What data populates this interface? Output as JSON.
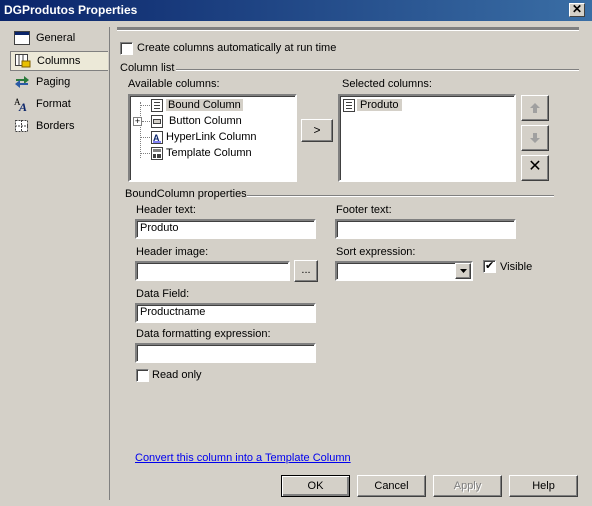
{
  "window": {
    "title": "DGProdutos Properties",
    "close_label": "✕"
  },
  "nav": [
    {
      "label": "General",
      "icon": "general-icon"
    },
    {
      "label": "Columns",
      "icon": "columns-icon",
      "selected": true
    },
    {
      "label": "Paging",
      "icon": "paging-icon"
    },
    {
      "label": "Format",
      "icon": "format-icon"
    },
    {
      "label": "Borders",
      "icon": "borders-icon"
    }
  ],
  "create_auto": {
    "label": "Create columns automatically at run time",
    "checked": false
  },
  "column_list": {
    "group_label": "Column list",
    "available_label": "Available columns:",
    "selected_label": "Selected columns:",
    "available": [
      {
        "label": "Bound Column",
        "icon": "bound-column-icon",
        "highlighted": true
      },
      {
        "label": "Button Column",
        "icon": "button-column-icon",
        "expander": "+"
      },
      {
        "label": "HyperLink Column",
        "icon": "hyperlink-column-icon"
      },
      {
        "label": "Template Column",
        "icon": "template-column-icon"
      }
    ],
    "selected": [
      {
        "label": "Produto",
        "icon": "bound-column-icon"
      }
    ],
    "add_label": ">",
    "up_icon": "arrow-up-icon",
    "down_icon": "arrow-down-icon",
    "delete_label": "✕"
  },
  "bound_props": {
    "group_label": "BoundColumn properties",
    "header_text_label": "Header text:",
    "header_text_value": "Produto",
    "footer_text_label": "Footer text:",
    "footer_text_value": "",
    "header_image_label": "Header image:",
    "header_image_value": "",
    "browse_label": "...",
    "sort_label": "Sort expression:",
    "sort_value": "",
    "visible_label": "Visible",
    "visible_checked": true,
    "data_field_label": "Data Field:",
    "data_field_value": "Productname",
    "format_label": "Data formatting expression:",
    "format_value": "",
    "readonly_label": "Read only",
    "readonly_checked": false
  },
  "convert_link": "Convert this column into a Template Column",
  "buttons": {
    "ok": "OK",
    "cancel": "Cancel",
    "apply": "Apply",
    "help": "Help"
  }
}
